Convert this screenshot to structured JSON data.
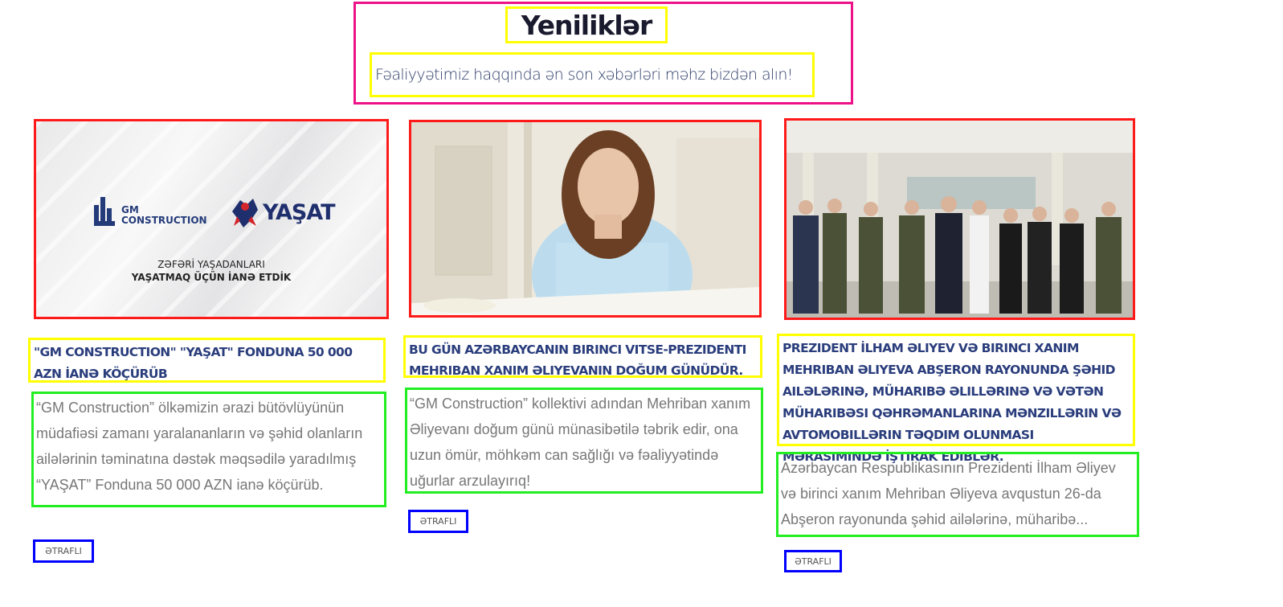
{
  "header": {
    "title": "Yeniliklər",
    "subtitle": "Fəaliyyətimiz haqqında ən son xəbərləri məhz bizdən alın!"
  },
  "cards": [
    {
      "image": {
        "alt": "GM Construction and YAŞAT logos",
        "brand_left": "GM",
        "brand_left_sub": "CONSTRUCTION",
        "brand_right": "YAŞAT",
        "caption_line1": "ZƏFƏRİ YAŞADANLARI",
        "caption_line2": "YAŞATMAQ ÜÇÜN İANƏ ETDİK"
      },
      "title": "\"GM CONSTRUCTION\" \"YAŞAT\" FONDUNA 50 000 AZN İANƏ KÖÇÜRÜB",
      "description": "“GM Construction” ölkəmizin ərazi bütövlüyünün müdafiəsi zamanı yaralananların və şəhid olanların ailələrinin təminatına dəstək məqsədilə yaradılmış “YAŞAT” Fonduna 50 000 AZN ianə köçürüb.",
      "button": "ƏTRAFLI"
    },
    {
      "image": {
        "alt": "Portrait of Mehriban Aliyeva at a desk"
      },
      "title": "BU GÜN AZƏRBAYCANIN BIRINCI VITSE-PREZIDENTI MEHRIBAN XANIM ƏLIYEVANIN DOĞUM GÜNÜDÜR.",
      "description": "“GM Construction” kollektivi adından Mehriban xanım Əliyevanı doğum günü münasibətilə təbrik edir, ona uzun ömür, möhkəm can sağlığı və fəaliyyətində uğurlar arzulayırıq!",
      "button": "ƏTRAFLI"
    },
    {
      "image": {
        "alt": "Group photo of the President with military personnel and families"
      },
      "title": "PREZIDENT İLHAM ƏLIYEV VƏ BIRINCI XANIM MEHRIBAN ƏLIYEVA ABŞERON RAYONUNDA ŞƏHID AILƏLƏRINƏ, MÜHARIBƏ ƏLILLƏRINƏ VƏ VƏTƏN MÜHARIBƏSI QƏHRƏMANLARINA MƏNZILLƏRIN VƏ AVTOMOBILLƏRIN TƏQDIM OLUNMASI MƏRASIMINDƏ İŞTIRAK EDIBLƏR.",
      "description": "Azərbaycan Respublikasının Prezidenti İlham Əliyev və birinci xanım Mehriban Əliyeva avqustun 26-da Abşeron rayonunda şəhid ailələrinə, müharibə...",
      "button": "ƏTRAFLI"
    }
  ],
  "colors": {
    "header_border": "#ee1289",
    "title_border": "#ffff00",
    "image_border": "#ff1a1a",
    "desc_border": "#22ee22",
    "button_border": "#0000ff",
    "title_color": "#2a3d7c",
    "desc_color": "#777777"
  }
}
